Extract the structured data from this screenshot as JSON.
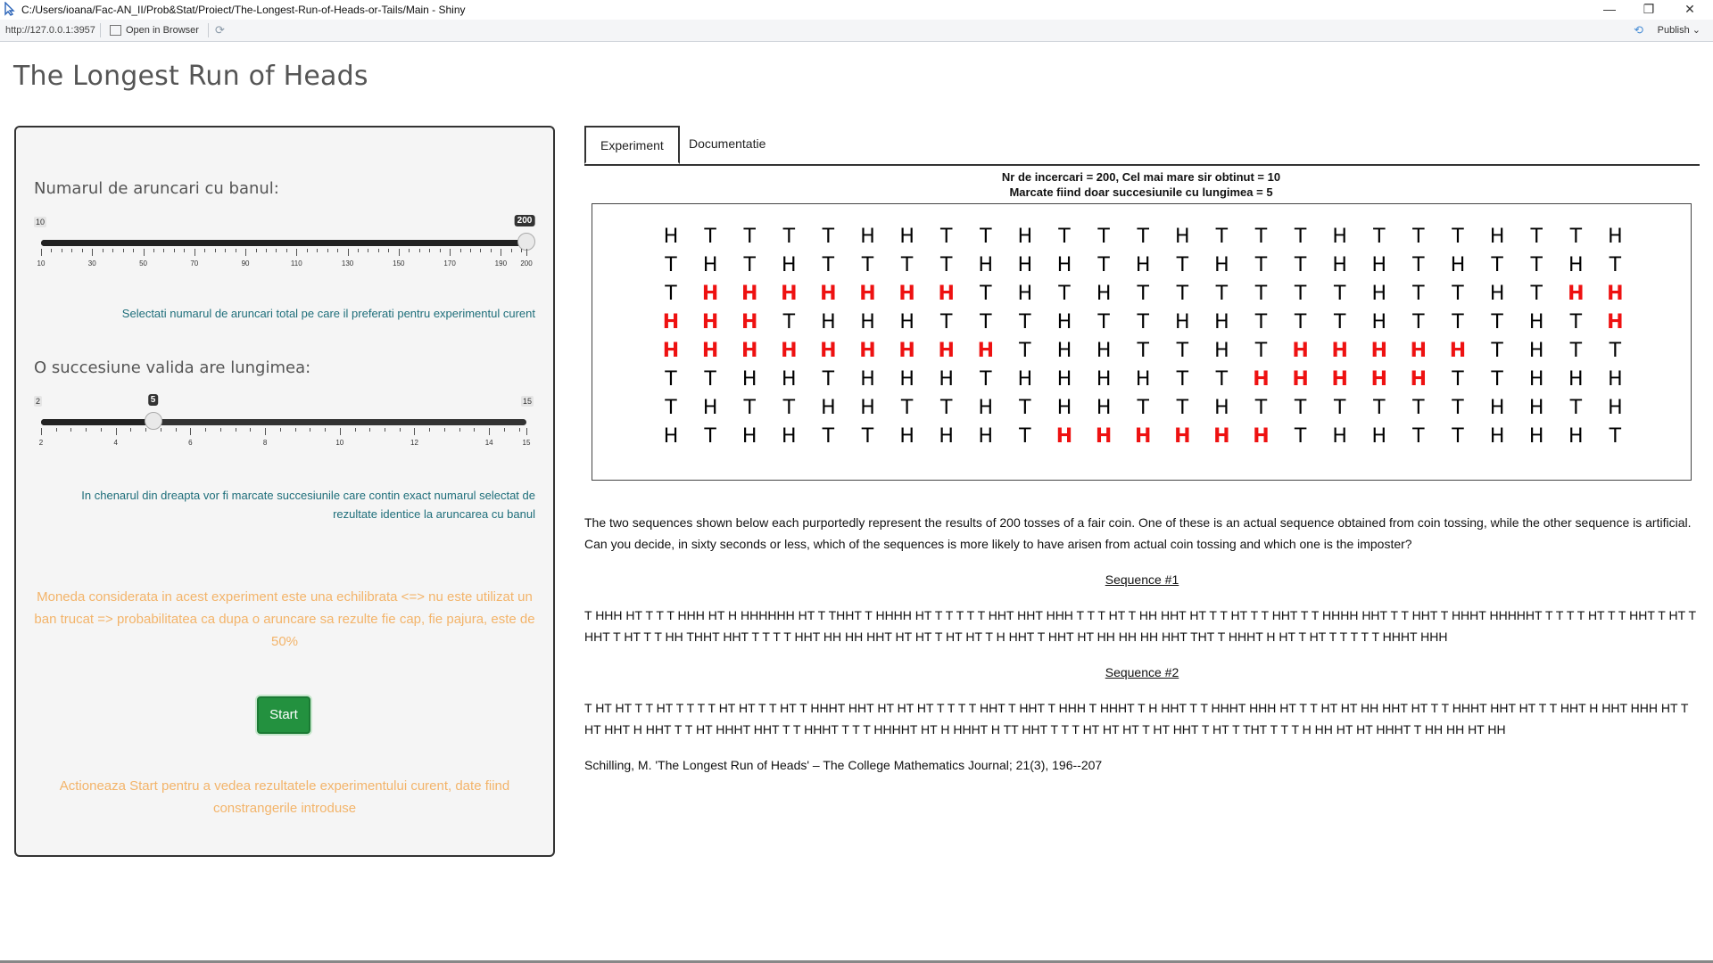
{
  "window": {
    "title": "C:/Users/ioana/Fac-AN_II/Prob&Stat/Proiect/The-Longest-Run-of-Heads-or-Tails/Main - Shiny",
    "minimize": "—",
    "restore": "❐",
    "close": "✕"
  },
  "toolbar": {
    "url": "http://127.0.0.1:3957",
    "open_in_browser": "Open in Browser",
    "refresh_icon": "⟳",
    "publish_label": "Publish",
    "publish_arrow": "⌄"
  },
  "app": {
    "title": "The Longest Run of Heads"
  },
  "sidebar": {
    "slider1": {
      "label": "Numarul de aruncari cu banul:",
      "min": 10,
      "max": 200,
      "value": 200,
      "min_label": "10",
      "max_label": "200",
      "value_label": "200",
      "tick_labels": [
        "10",
        "30",
        "50",
        "70",
        "90",
        "110",
        "130",
        "150",
        "170",
        "190",
        "200"
      ]
    },
    "help1": "Selectati numarul de aruncari total pe care il preferati pentru experimentul curent",
    "slider2": {
      "label": "O succesiune valida are lungimea:",
      "min": 2,
      "max": 15,
      "value": 5,
      "min_label": "2",
      "max_label": "15",
      "value_label": "5",
      "tick_labels": [
        "2",
        "4",
        "6",
        "8",
        "10",
        "12",
        "14",
        "15"
      ]
    },
    "help2": "In chenarul din dreapta vor fi marcate succesiunile care contin exact numarul selectat de rezultate identice la aruncarea cu banul",
    "coin_note": "Moneda considerata in acest experiment este una echilibrata <=> nu este utilizat un ban trucat => probabilitatea ca dupa o aruncare sa rezulte fie cap, fie pajura, este de 50%",
    "start_label": "Start",
    "start_note": "Actioneaza Start pentru a vedea rezultatele experimentului curent, date fiind constrangerile introduse"
  },
  "tabs": [
    {
      "label": "Experiment",
      "active": true
    },
    {
      "label": "Documentatie",
      "active": false
    }
  ],
  "plot": {
    "title_line1": "Nr de incercari = 200, Cel mai mare sir obtinut = 10",
    "title_line2": "Marcate fiind doar succesiunile cu lungimea = 5",
    "rows": [
      "HTTTTHHTTHTTTHTTTHTTTHTTH",
      "THTHTTTTHHHTHTHTTHHTHTTHT",
      "THHHHHHHTHTHTTTTTTHTTHTHH",
      "HHHTHHHTTTHTTHHTTTHTTTHTH",
      "HHHHHHHHHTHHTTHTHHHHHTHTT",
      "TTHHTHHHTHHHHTTHHHHHTTHHH",
      "THTTHHTTHTHHTTHTTTTTTHHTH",
      "HTHHTTHHHTHHHHHHTHHTTHHHT"
    ],
    "red_mask": [
      "0000000000000000000000000",
      "0000000000000000000000000",
      "0111111100000000000000011",
      "1110000000000000000000001",
      "1111111110000000111110000",
      "0000000000000001111100000",
      "0000000000000000000000000",
      "0000000000111111000000000"
    ],
    "red_color": "#ee1111"
  },
  "text": {
    "intro": "The two sequences shown below each purportedly represent the results of 200 tosses of a fair coin. One of these is an actual sequence obtained from coin tossing, while the other sequence is artificial. Can you decide, in sixty seconds or less, which of the sequences is more likely to have arisen from actual coin tossing and which one is the imposter?",
    "seq1_heading": "Sequence #1",
    "seq1": "T HHH HT T T T HHH HT H HHHHHH HT T THHT T HHHH HT T T T T T HHT HHT HHH T T T HT T HH HHT HT T T HT T T HHT T T HHHH HHT T T HHT T HHHT HHHHHT T T T T HT T T HHT T HT T HHT T HT T T HH THHT HHT T T T T HHT HH HH HHT HT HT T HT HT T H HHT T HHT HT HH HH HH HHT THT T HHHT H HT T HT T T T T T HHHT HHH",
    "seq2_heading": "Sequence #2",
    "seq2": "T HT HT T T HT T T T T HT HT T T HT T HHHT HHT HT HT HT T T T T HHT T HHT T HHH T HHHT T H HHT T T HHHT HHH HT T T HT HT HH HHT HT T T HHHT HHT HT T T HHT H HHT HHH HT T HT HHT H HHT T T HT HHHT HHT T T HHHT T T T HHHHT HT H HHHT H TT HHT T T T HT HT HT T HT HHT T HT T THT T T T H HH HT HT HHHT T HH HH HT HH",
    "citation": "Schilling, M. 'The Longest Run of Heads' – The College Mathematics Journal; 21(3), 196--207"
  }
}
